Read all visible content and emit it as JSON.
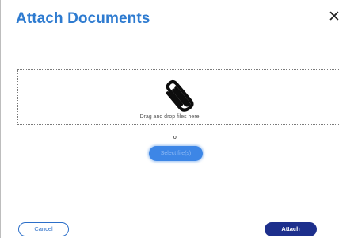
{
  "dialog": {
    "title": "Attach Documents",
    "close_icon": "close-icon"
  },
  "dropzone": {
    "icon": "paperclip-icon",
    "text": "Drag and drop files here"
  },
  "separator": {
    "text": "or"
  },
  "select_button": {
    "label": "Select file(s)"
  },
  "footer": {
    "cancel_label": "Cancel",
    "attach_label": "Attach"
  },
  "colors": {
    "title": "#2e7bd0",
    "primary_button": "#1d2f8c",
    "select_button": "#3d86e6"
  }
}
